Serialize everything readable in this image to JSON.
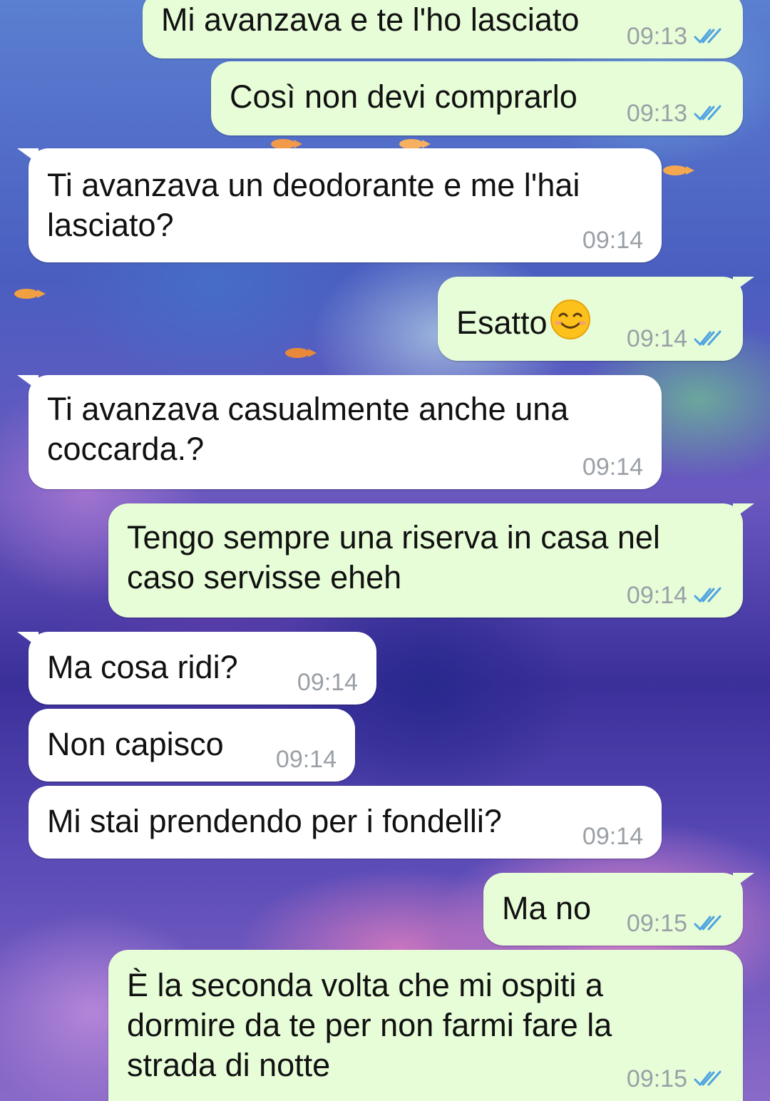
{
  "colors": {
    "outgoing_bubble": "#e7fdd8",
    "incoming_bubble": "#ffffff",
    "time_text": "#9aa0a6",
    "read_ticks": "#4fa3e0"
  },
  "messages": [
    {
      "direction": "out",
      "text": "Mi avanzava e te l'ho lasciato",
      "time": "09:13",
      "status_icon": "double-check-read-icon"
    },
    {
      "direction": "out",
      "text": "Così non devi comprarlo",
      "time": "09:13",
      "status_icon": "double-check-read-icon"
    },
    {
      "direction": "in",
      "text": "Ti avanzava un deodorante e me l'hai\nlasciato?",
      "time": "09:14"
    },
    {
      "direction": "out",
      "text": "Esatto",
      "emoji": "smiling-face-icon",
      "time": "09:14",
      "status_icon": "double-check-read-icon"
    },
    {
      "direction": "in",
      "text": "Ti avanzava casualmente anche una\ncoccarda.?",
      "time": "09:14"
    },
    {
      "direction": "out",
      "text": "Tengo sempre una riserva in casa nel\ncaso servisse eheh",
      "time": "09:14",
      "status_icon": "double-check-read-icon"
    },
    {
      "direction": "in",
      "text": "Ma cosa ridi?",
      "time": "09:14"
    },
    {
      "direction": "in",
      "text": "Non capisco",
      "time": "09:14"
    },
    {
      "direction": "in",
      "text": "Mi stai prendendo per i fondelli?",
      "time": "09:14"
    },
    {
      "direction": "out",
      "text": "Ma no",
      "time": "09:15",
      "status_icon": "double-check-read-icon"
    },
    {
      "direction": "out",
      "text": "È la seconda volta che mi ospiti a\ndormire da te per non farmi fare la\nstrada di notte",
      "time": "09:15",
      "status_icon": "double-check-read-icon"
    }
  ]
}
